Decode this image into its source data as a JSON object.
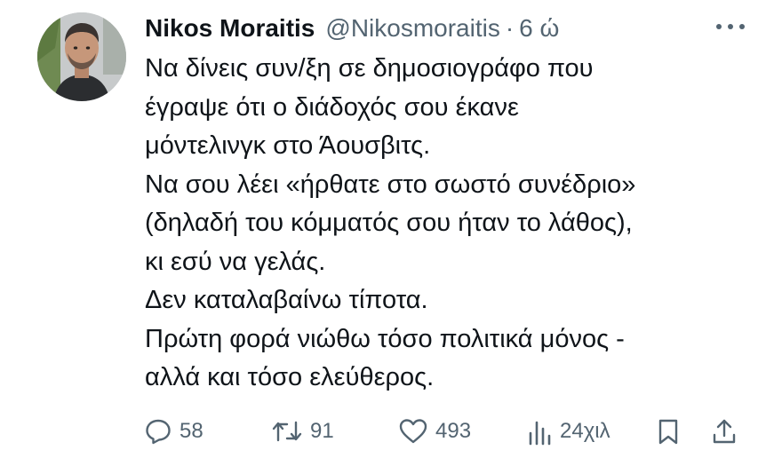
{
  "author": {
    "name": "Nikos Moraitis",
    "handle": "@Nikosmoraitis",
    "separator": "·",
    "time": "6 ώ"
  },
  "tweet": {
    "lines": [
      "Να δίνεις συν/ξη σε δημοσιογράφο που",
      "έγραψε ότι ο διάδοχός σου έκανε",
      "μόντελινγκ στο Άουσβιτς.",
      "Να σου λέει «ήρθατε στο σωστό συνέδριο»",
      "(δηλαδή του κόμματός σου ήταν το λάθος),",
      "κι εσύ να γελάς.",
      "Δεν καταλαβαίνω τίποτα.",
      "Πρώτη φορά νιώθω τόσο πολιτικά μόνος -",
      "αλλά και τόσο ελεύθερος."
    ]
  },
  "stats": {
    "replies": "58",
    "retweets": "91",
    "likes": "493",
    "views": "24χιλ"
  },
  "icons": {
    "reply": "reply-icon",
    "retweet": "retweet-icon",
    "like": "heart-icon",
    "views": "views-icon",
    "bookmark": "bookmark-icon",
    "share": "share-icon",
    "more": "more-icon"
  },
  "colors": {
    "text": "#0f1419",
    "secondary": "#536471",
    "background": "#ffffff"
  }
}
